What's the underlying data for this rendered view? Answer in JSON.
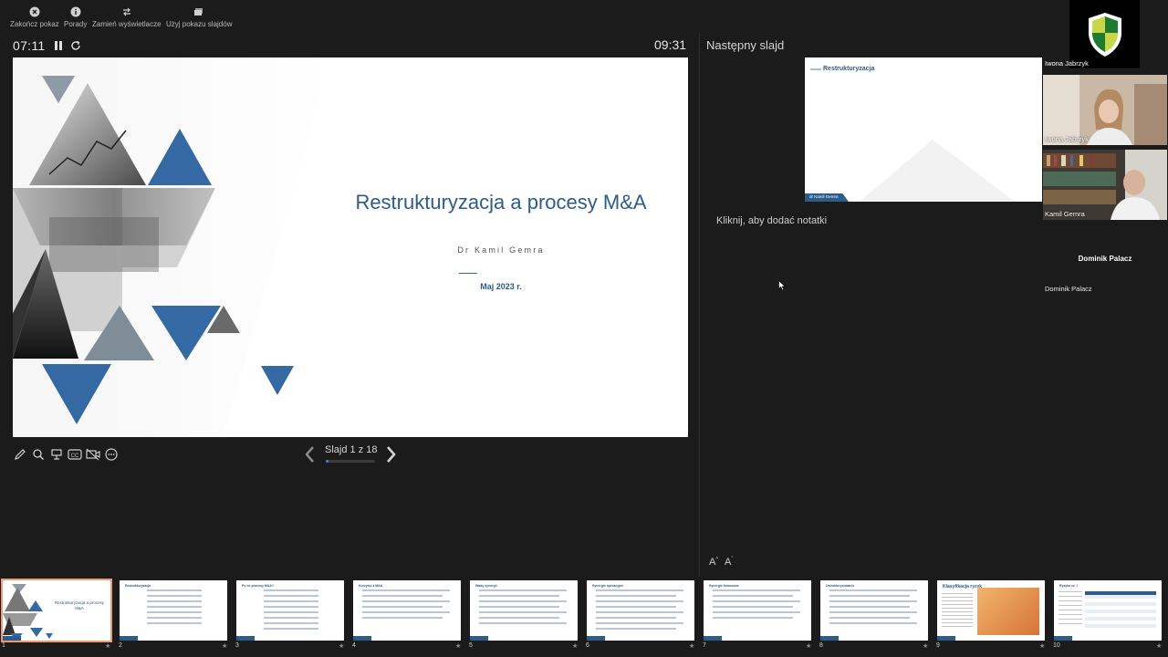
{
  "toolbar": {
    "end_show": "Zakończ pokaz",
    "tips": "Porady",
    "swap_displays": "Zamień wyświetlacze",
    "use_slideshow": "Użyj pokazu slajdów"
  },
  "presenter": {
    "elapsed": "07:11",
    "clock": "09:31",
    "slide_counter": "Slajd 1 z 18",
    "progress_fraction": 0.056
  },
  "slide": {
    "title": "Restrukturyzacja a procesy M&A",
    "author": "Dr Kamil Gemra",
    "date": "Maj 2023 r."
  },
  "next": {
    "label": "Następny slajd",
    "title": "Restrukturyzacja",
    "tag": "dr Kamil Gemra"
  },
  "notes": {
    "hint": "Kliknij, aby dodać notatki",
    "font_up": "A",
    "font_down": "A"
  },
  "participants": {
    "label_over": "Iwona Jabrzyk",
    "p1": "Iwona Jabrzyk",
    "p2": "Kamil Gemra",
    "p3_center": "Dominik Palacz",
    "p3_name": "Dominik Palacz"
  },
  "thumbnails": [
    {
      "num": "1",
      "title": "Restrukturyzacja a procesy M&A",
      "star": "★"
    },
    {
      "num": "2",
      "title": "Restrukturyzacja",
      "star": "★"
    },
    {
      "num": "3",
      "title": "Po co procesy M&A?",
      "star": "★"
    },
    {
      "num": "4",
      "title": "Korzyści z M&A",
      "star": "★"
    },
    {
      "num": "5",
      "title": "Wady synergii",
      "star": "★"
    },
    {
      "num": "6",
      "title": "Synergie operacyjne",
      "star": "★"
    },
    {
      "num": "7",
      "title": "Synergie finansowe",
      "star": "★"
    },
    {
      "num": "8",
      "title": "Ustrukturyzowanie",
      "star": "★"
    },
    {
      "num": "9",
      "title": "Klasyfikacja ryzyk",
      "star": "★"
    },
    {
      "num": "10",
      "title": "Ryzyka cz. I",
      "star": "★"
    }
  ],
  "colors": {
    "accent_blue": "#2d5b8a",
    "triangle_blue": "#3569a4",
    "active_outline": "#f09a78"
  }
}
